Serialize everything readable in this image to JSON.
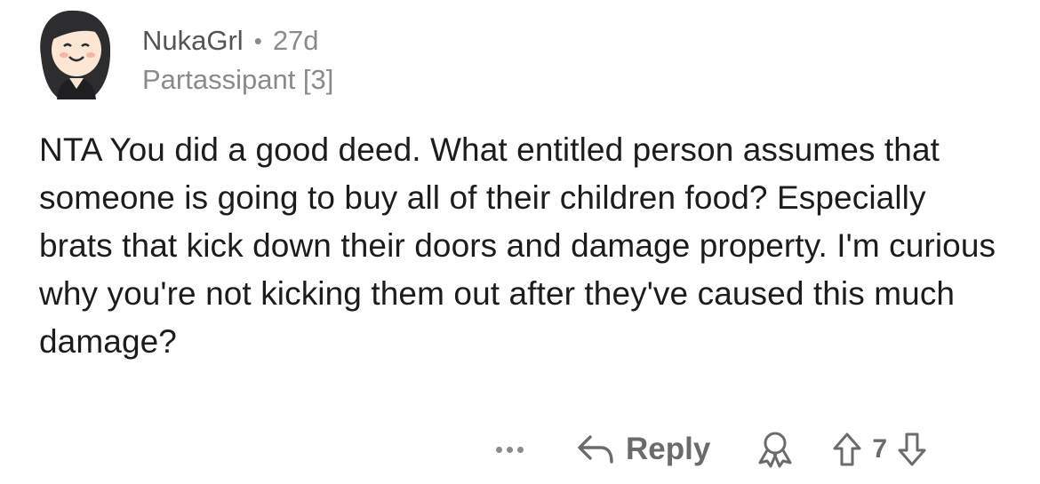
{
  "comment": {
    "author": "NukaGrl",
    "separator": "•",
    "age": "27d",
    "flair": "Partassipant [3]",
    "body": "NTA You did a good deed. What entitled person assumes that someone is going to buy all of their children food? Especially brats that kick down their doors and damage property. I'm curious why you're not kicking them out after they've caused this much damage?"
  },
  "actions": {
    "more_icon": "more-dots-icon",
    "reply_icon": "reply-arrow-icon",
    "reply_label": "Reply",
    "award_icon": "award-icon",
    "upvote_icon": "upvote-arrow-icon",
    "score": "7",
    "downvote_icon": "downvote-arrow-icon"
  },
  "colors": {
    "icon_gray": "#6b6b6e",
    "meta_gray": "#8a8a8d",
    "text": "#1c1c1e"
  }
}
